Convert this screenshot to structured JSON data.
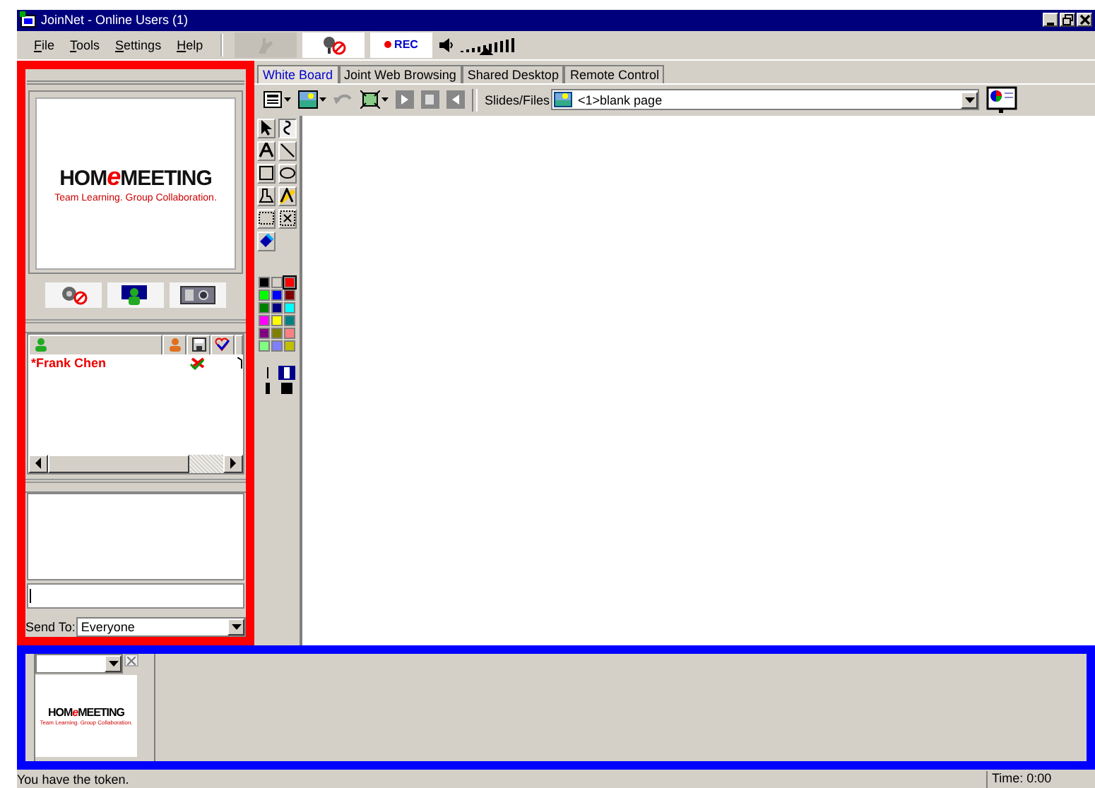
{
  "window": {
    "title": "JoinNet - Online Users (1)"
  },
  "menu": [
    "File",
    "Tools",
    "Settings",
    "Help"
  ],
  "toolbar": {
    "hand_disabled": true,
    "rec_label": "REC",
    "volume": {
      "level": 0.45
    }
  },
  "logo": {
    "start": "HOM",
    "mark": "e",
    "end": "MEETING",
    "tagline": "Team Learning. Group Collaboration."
  },
  "users": {
    "rows": [
      {
        "name": "*Frank Chen",
        "selected": false
      }
    ]
  },
  "chat": {
    "send_to_label": "Send To:",
    "send_to": "Everyone"
  },
  "tabs": [
    {
      "label": "White Board",
      "selected": true
    },
    {
      "label": "Joint Web Browsing",
      "selected": false
    },
    {
      "label": "Shared Desktop",
      "selected": false
    },
    {
      "label": "Remote Control",
      "selected": false
    }
  ],
  "slides": {
    "label": "Slides/Files",
    "value": "<1>blank page"
  },
  "tools": [
    {
      "kind": "pointer",
      "selected": false
    },
    {
      "kind": "freehand",
      "selected": true
    },
    {
      "kind": "text",
      "selected": false
    },
    {
      "kind": "line",
      "selected": false
    },
    {
      "kind": "rect",
      "selected": false
    },
    {
      "kind": "ellipse",
      "selected": false
    },
    {
      "kind": "eraser",
      "selected": false
    },
    {
      "kind": "highlight",
      "selected": false
    },
    {
      "kind": "marquee",
      "selected": false
    },
    {
      "kind": "zoom",
      "selected": false
    },
    {
      "kind": "fill",
      "selected": false
    }
  ],
  "colors": [
    {
      "color": "#000000",
      "selected": false
    },
    {
      "color": "#d4d0c8",
      "selected": false
    },
    {
      "color": "#ff0000",
      "selected": true
    },
    {
      "color": "#00ff00",
      "selected": false
    },
    {
      "color": "#0000ff",
      "selected": false
    },
    {
      "color": "#800000",
      "selected": false
    },
    {
      "color": "#008000",
      "selected": false
    },
    {
      "color": "#000080",
      "selected": false
    },
    {
      "color": "#00ffff",
      "selected": false
    },
    {
      "color": "#ff00ff",
      "selected": false
    },
    {
      "color": "#ffff00",
      "selected": false
    },
    {
      "color": "#008080",
      "selected": false
    },
    {
      "color": "#800080",
      "selected": false
    },
    {
      "color": "#808000",
      "selected": false
    },
    {
      "color": "#ff8080",
      "selected": false
    },
    {
      "color": "#80ff80",
      "selected": false
    },
    {
      "color": "#8080ff",
      "selected": false
    },
    {
      "color": "#c0c000",
      "selected": false
    }
  ],
  "thumbnail": {
    "start": "HOM",
    "mark": "e",
    "end": "MEETING",
    "tagline": "Team Learning. Group Collaboration."
  },
  "status_bar": {
    "message": "You have the token.",
    "time": "Time: 0:00"
  }
}
